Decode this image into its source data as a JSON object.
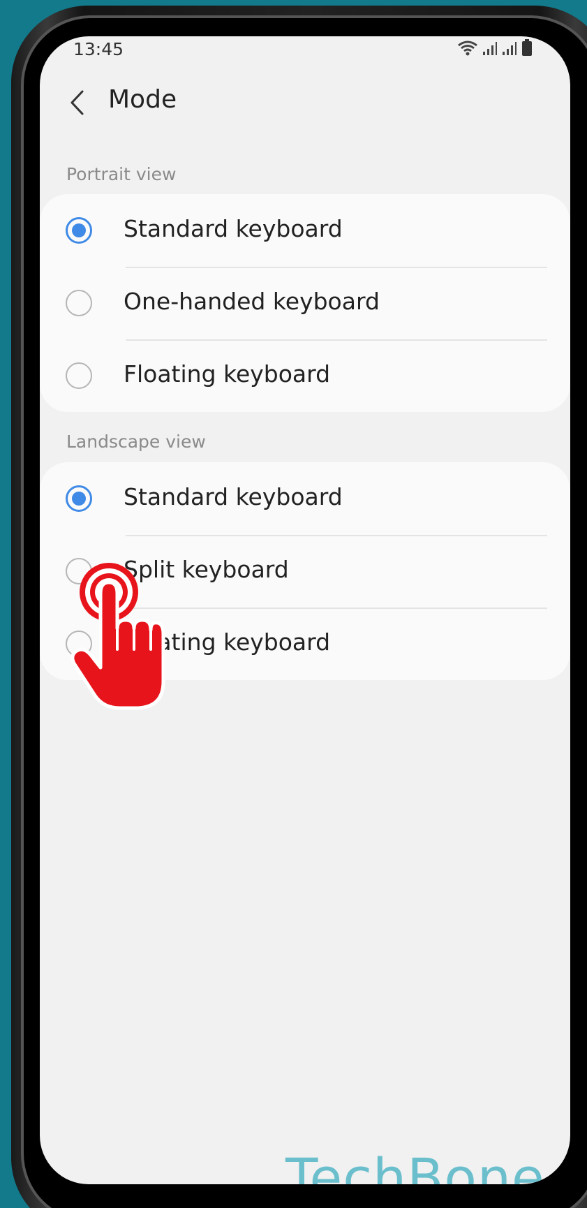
{
  "status_bar": {
    "time": "13:45"
  },
  "header": {
    "title": "Mode"
  },
  "portrait": {
    "label": "Portrait view",
    "options": [
      {
        "label": "Standard keyboard",
        "selected": true
      },
      {
        "label": "One-handed keyboard",
        "selected": false
      },
      {
        "label": "Floating keyboard",
        "selected": false
      }
    ]
  },
  "landscape": {
    "label": "Landscape view",
    "options": [
      {
        "label": "Standard keyboard",
        "selected": true
      },
      {
        "label": "Split keyboard",
        "selected": false
      },
      {
        "label": "Floating keyboard",
        "selected": false
      }
    ]
  },
  "overlay": {
    "icon": "tap-hand-icon",
    "color": "#e8141c"
  },
  "watermark": "TechBone",
  "colors": {
    "background": "#127a8a",
    "accent": "#3e8ae6",
    "watermark": "#6bbfcc"
  }
}
